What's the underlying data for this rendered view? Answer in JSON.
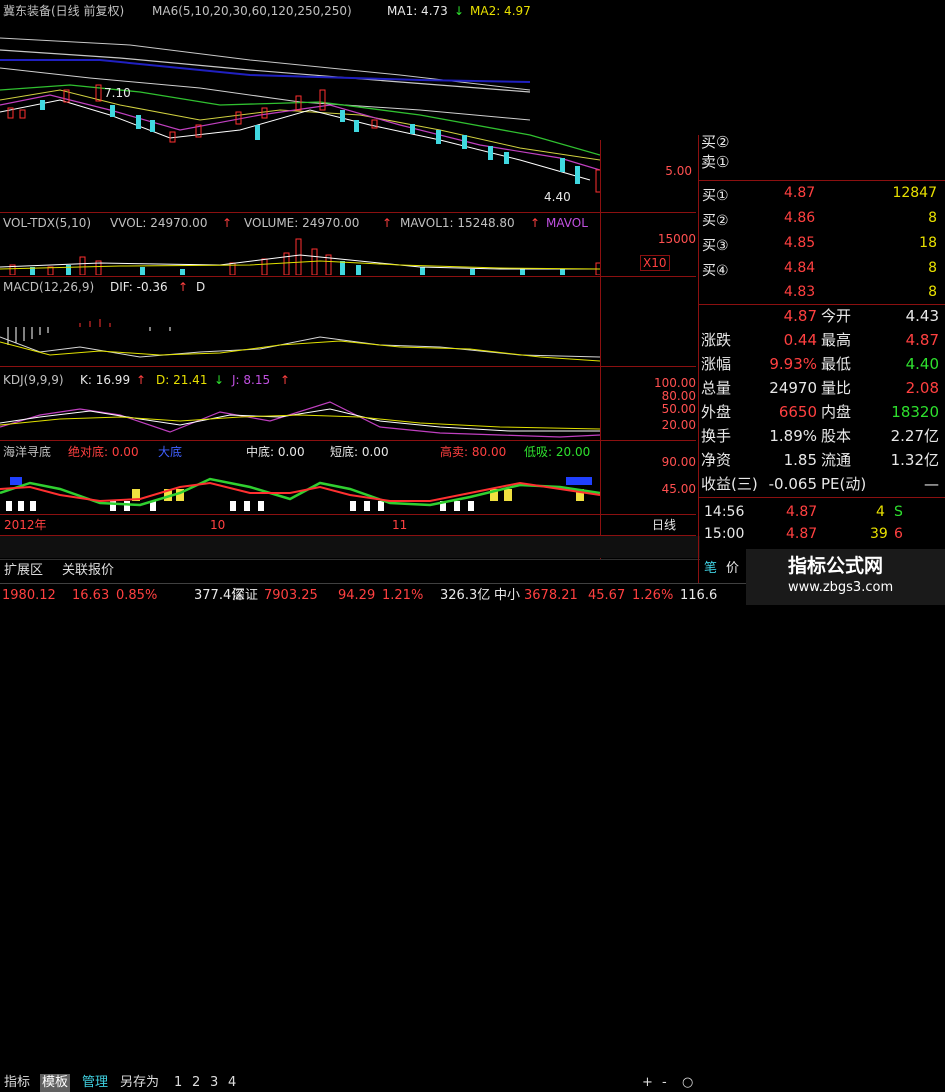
{
  "main_chart": {
    "title": "冀东装备(日线 前复权)",
    "ma_label": "MA6(5,10,20,30,60,120,250,250)",
    "ma1": "MA1: 4.73",
    "ma2": "MA2: 4.97",
    "arrow_down": "↓",
    "high_note": "7.10",
    "low_note": "4.40",
    "axis_price": "5.00"
  },
  "vol_panel": {
    "name": "VOL-TDX(5,10)",
    "vvol": "VVOL: 24970.00",
    "volume": "VOLUME: 24970.00",
    "mavol1": "MAVOL1: 15248.80",
    "mavol": "MAVOL",
    "arrow_up": "↑",
    "axis": "15000",
    "x10": "X10"
  },
  "macd_panel": {
    "name": "MACD(12,26,9)",
    "dif": "DIF: -0.36",
    "d": "D"
  },
  "kdj_panel": {
    "name": "KDJ(9,9,9)",
    "k": "K: 16.99",
    "d": "D: 21.41",
    "j": "J: 8.15",
    "axis": [
      "100.00",
      "80.00",
      "50.00",
      "20.00"
    ]
  },
  "hyxd_panel": {
    "name": "海洋寻底",
    "abs_bottom": "绝对底: 0.00",
    "big_bottom": "大底",
    "mid_bottom": "中底: 0.00",
    "short_bottom": "短底: 0.00",
    "high_sell": "高卖: 80.00",
    "low_buy": "低吸: 20.00",
    "axis": [
      "90.00",
      "45.00"
    ]
  },
  "date_axis": {
    "year": "2012年",
    "m10": "10",
    "m11": "11",
    "period": "日线"
  },
  "tabs": [
    "指标",
    "模板",
    "管理",
    "另存为",
    "1",
    "2",
    "3",
    "4"
  ],
  "bottom_links": [
    "扩展区",
    "关联报价"
  ],
  "nav_buttons": [
    "+",
    "-",
    "○"
  ],
  "order_book": {
    "sell_partial": [
      "买②",
      "卖①"
    ],
    "buy": [
      {
        "label": "买①",
        "price": "4.87",
        "vol": "12847"
      },
      {
        "label": "买②",
        "price": "4.86",
        "vol": "8"
      },
      {
        "label": "买③",
        "price": "4.85",
        "vol": "18"
      },
      {
        "label": "买④",
        "price": "4.84",
        "vol": "8"
      },
      {
        "label": "",
        "price": "4.83",
        "vol": "8"
      }
    ]
  },
  "quote": [
    {
      "l1": "",
      "v1": "4.87",
      "l2": "今开",
      "v2": "4.43",
      "c1": "red",
      "c2": "white"
    },
    {
      "l1": "涨跌",
      "v1": "0.44",
      "l2": "最高",
      "v2": "4.87",
      "c1": "red",
      "c2": "red"
    },
    {
      "l1": "涨幅",
      "v1": "9.93%",
      "l2": "最低",
      "v2": "4.40",
      "c1": "red",
      "c2": "green"
    },
    {
      "l1": "总量",
      "v1": "24970",
      "l2": "量比",
      "v2": "2.08",
      "c1": "white",
      "c2": "red"
    },
    {
      "l1": "外盘",
      "v1": "6650",
      "l2": "内盘",
      "v2": "18320",
      "c1": "red",
      "c2": "green"
    },
    {
      "l1": "换手",
      "v1": "1.89%",
      "l2": "股本",
      "v2": "2.27亿",
      "c1": "white",
      "c2": "white"
    },
    {
      "l1": "净资",
      "v1": "1.85",
      "l2": "流通",
      "v2": "1.32亿",
      "c1": "white",
      "c2": "white"
    },
    {
      "l1": "收益(三)",
      "v1": "-0.065",
      "l2": "PE(动)",
      "v2": "—",
      "c1": "white",
      "c2": "white"
    }
  ],
  "ticks": [
    {
      "time": "14:56",
      "price": "4.87",
      "vol": "4",
      "flag": "S"
    },
    {
      "time": "15:00",
      "price": "4.87",
      "vol": "39",
      "flag": "6"
    }
  ],
  "side_tabs": [
    "笔",
    "价"
  ],
  "watermark": {
    "line1": "指标公式网",
    "line2": "www.zbgs3.com"
  },
  "ticker": [
    {
      "text": "1980.12",
      "color": "red"
    },
    {
      "text": "16.63",
      "color": "red"
    },
    {
      "text": "0.85%",
      "color": "red"
    },
    {
      "text": "377.4亿",
      "color": "white"
    },
    {
      "text": "深证",
      "color": "white"
    },
    {
      "text": "7903.25",
      "color": "red"
    },
    {
      "text": "94.29",
      "color": "red"
    },
    {
      "text": "1.21%",
      "color": "red"
    },
    {
      "text": "326.3亿",
      "color": "white"
    },
    {
      "text": "中小",
      "color": "white"
    },
    {
      "text": "3678.21",
      "color": "red"
    },
    {
      "text": "45.67",
      "color": "red"
    },
    {
      "text": "1.26%",
      "color": "red"
    },
    {
      "text": "116.6",
      "color": "white"
    }
  ]
}
